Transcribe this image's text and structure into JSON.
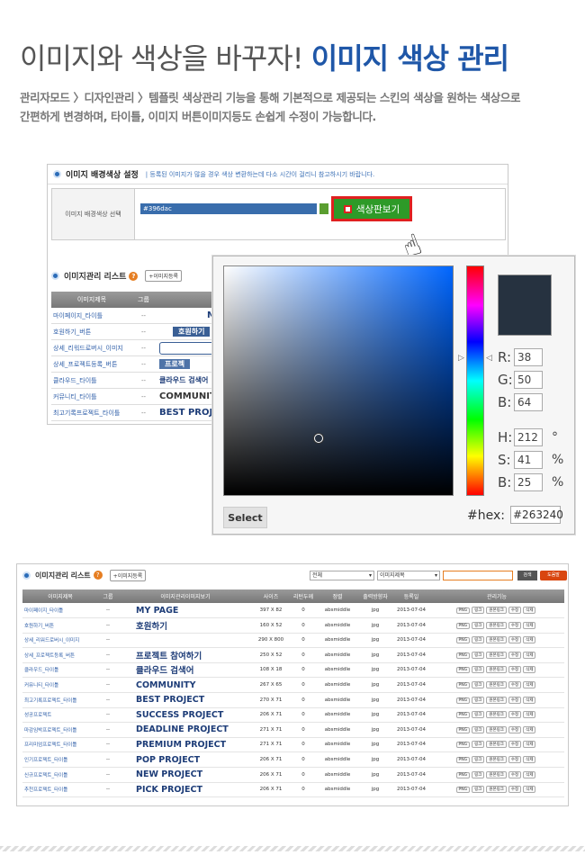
{
  "header": {
    "title_plain": "이미지와 색상을 바꾸자! ",
    "title_accent": "이미지 색상 관리",
    "desc_line1": "관리자모드 〉디자인관리 〉템플릿 색상관리 기능을 통해 기본적으로 제공되는 스킨의 색상을 원하는 색상으로",
    "desc_line2": "간편하게 변경하며, 타이틀, 이미지 버튼이미지등도 손쉽게 수정이 가능합니다."
  },
  "bg_panel": {
    "title": "이미지 배경색상 설정",
    "note": "| 등록된 이미지가 많을 경우 색상 변환하는데 다소 시간이 걸리니 참고하시기 바랍니다.",
    "row_label": "이미지 배경색상 선택",
    "hex_value": "#396dac",
    "pick_button": "색상판보기",
    "accent_color": "#396dac"
  },
  "list1": {
    "title": "이미지관리 리스트",
    "help": "?",
    "add_button": "+이미지등록",
    "headers": [
      "이미지제목",
      "그룹",
      "이미"
    ],
    "rows": [
      {
        "name": "마이페이지_타이틀",
        "group": "--",
        "preview": "M"
      },
      {
        "name": "호원하기_버튼",
        "group": "--",
        "preview": "호원하기"
      },
      {
        "name": "상세_리워드로버시_이미지",
        "group": "--",
        "preview": ""
      },
      {
        "name": "상세_프로젝트등록_버튼",
        "group": "--",
        "preview": "프로젝"
      },
      {
        "name": "클라우드_타이틀",
        "group": "--",
        "preview": "클라우드 검색어"
      },
      {
        "name": "커뮤니티_타이틀",
        "group": "--",
        "preview": "COMMUNITY"
      },
      {
        "name": "최고기록프로젝트_타이틀",
        "group": "--",
        "preview": "BEST PROJECT"
      }
    ]
  },
  "picker": {
    "R": "38",
    "G": "50",
    "B": "64",
    "H": "212",
    "S": "41",
    "Bv": "25",
    "hex_label": "#hex:",
    "hex": "#263240",
    "select": "Select",
    "swatch_color": "#263240",
    "deg": "°",
    "pct": "%",
    "labels": {
      "r": "R:",
      "g": "G:",
      "b": "B:",
      "h": "H:",
      "s": "S:",
      "bv": "B:"
    }
  },
  "list2": {
    "title": "이미지관리 리스트",
    "help": "?",
    "add_button": "+이미지등록",
    "filter_all": "전체",
    "filter_field": "이미지제목",
    "search_button": "검색",
    "help_button": "도움말",
    "headers": [
      "이미지제목",
      "그룹",
      "이미지관리이미지보기",
      "사이즈",
      "리턴두께",
      "정렬",
      "출력방향자",
      "등록일",
      "관리기능"
    ],
    "actions": [
      "PNG",
      "링크",
      "원본링크",
      "수정",
      "삭제"
    ],
    "rows": [
      {
        "name": "마이페이지_타이틀",
        "group": "--",
        "preview": "MY PAGE",
        "size": "397 X 82",
        "ret": "0",
        "align": "absmiddle",
        "fmt": "jpg",
        "date": "2013-07-04"
      },
      {
        "name": "호원하기_버튼",
        "group": "--",
        "preview": "호원하기",
        "size": "160 X 52",
        "ret": "0",
        "align": "absmiddle",
        "fmt": "jpg",
        "date": "2013-07-04"
      },
      {
        "name": "상세_리워드로버시_이미지",
        "group": "--",
        "preview": "",
        "size": "290 X 800",
        "ret": "0",
        "align": "absmiddle",
        "fmt": "jpg",
        "date": "2013-07-04"
      },
      {
        "name": "상세_프로젝트등록_버튼",
        "group": "--",
        "preview": "프로젝트 참여하기",
        "size": "250 X 52",
        "ret": "0",
        "align": "absmiddle",
        "fmt": "jpg",
        "date": "2013-07-04"
      },
      {
        "name": "클라우드_타이틀",
        "group": "--",
        "preview": "클라우드 검색어",
        "size": "108 X 18",
        "ret": "0",
        "align": "absmiddle",
        "fmt": "jpg",
        "date": "2013-07-04"
      },
      {
        "name": "커뮤니티_타이틀",
        "group": "--",
        "preview": "COMMUNITY",
        "size": "267 X 65",
        "ret": "0",
        "align": "absmiddle",
        "fmt": "jpg",
        "date": "2013-07-04"
      },
      {
        "name": "최고기록프로젝트_타이틀",
        "group": "--",
        "preview": "BEST PROJECT",
        "size": "270 X 71",
        "ret": "0",
        "align": "absmiddle",
        "fmt": "jpg",
        "date": "2013-07-04"
      },
      {
        "name": "성공프로젝트",
        "group": "--",
        "preview": "SUCCESS PROJECT",
        "size": "206 X 71",
        "ret": "0",
        "align": "absmiddle",
        "fmt": "jpg",
        "date": "2013-07-04"
      },
      {
        "name": "마감임박프로젝트_타이틀",
        "group": "--",
        "preview": "DEADLINE PROJECT",
        "size": "271 X 71",
        "ret": "0",
        "align": "absmiddle",
        "fmt": "jpg",
        "date": "2013-07-04"
      },
      {
        "name": "프리미엄프로젝트_타이틀",
        "group": "--",
        "preview": "PREMIUM PROJECT",
        "size": "271 X 71",
        "ret": "0",
        "align": "absmiddle",
        "fmt": "jpg",
        "date": "2013-07-04"
      },
      {
        "name": "인기프로젝트_타이틀",
        "group": "--",
        "preview": "POP PROJECT",
        "size": "206 X 71",
        "ret": "0",
        "align": "absmiddle",
        "fmt": "jpg",
        "date": "2013-07-04"
      },
      {
        "name": "신규프로젝트_타이틀",
        "group": "--",
        "preview": "NEW PROJECT",
        "size": "206 X 71",
        "ret": "0",
        "align": "absmiddle",
        "fmt": "jpg",
        "date": "2013-07-04"
      },
      {
        "name": "추천프로젝트_타이틀",
        "group": "--",
        "preview": "PICK PROJECT",
        "size": "206 X 71",
        "ret": "0",
        "align": "absmiddle",
        "fmt": "jpg",
        "date": "2013-07-04"
      }
    ]
  }
}
